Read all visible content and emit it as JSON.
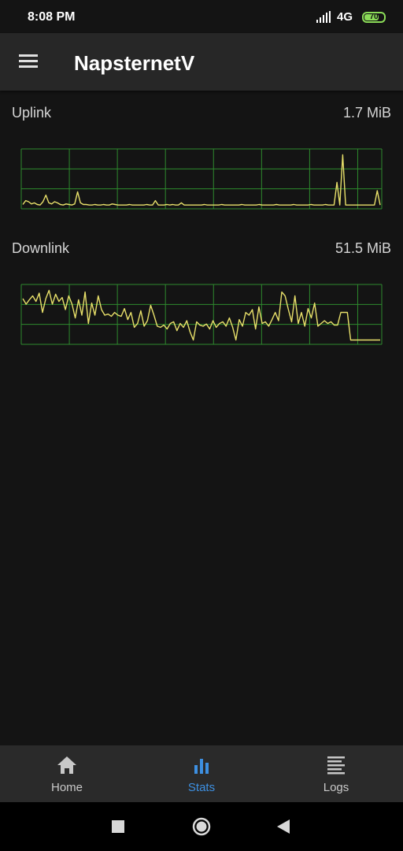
{
  "status_bar": {
    "time": "8:08 PM",
    "network": "4G",
    "battery_level": "70",
    "battery_color": "#8bdc58"
  },
  "app_bar": {
    "title": "NapsternetV",
    "menu_icon": "hamburger-menu-icon"
  },
  "stats": {
    "uplink": {
      "label": "Uplink",
      "value": "1.7 MiB",
      "trace": [
        0.05,
        0.12,
        0.1,
        0.06,
        0.08,
        0.05,
        0.04,
        0.1,
        0.22,
        0.08,
        0.06,
        0.1,
        0.08,
        0.05,
        0.04,
        0.06,
        0.05,
        0.04,
        0.06,
        0.28,
        0.08,
        0.05,
        0.05,
        0.04,
        0.04,
        0.05,
        0.04,
        0.04,
        0.05,
        0.04,
        0.04,
        0.06,
        0.05,
        0.04,
        0.04,
        0.04,
        0.04,
        0.05,
        0.04,
        0.04,
        0.04,
        0.04,
        0.04,
        0.05,
        0.04,
        0.04,
        0.12,
        0.04,
        0.04,
        0.04,
        0.05,
        0.04,
        0.05,
        0.04,
        0.04,
        0.08,
        0.04,
        0.04,
        0.04,
        0.04,
        0.04,
        0.04,
        0.04,
        0.05,
        0.04,
        0.04,
        0.04,
        0.04,
        0.04,
        0.05,
        0.04,
        0.04,
        0.04,
        0.04,
        0.04,
        0.04,
        0.05,
        0.04,
        0.04,
        0.04,
        0.04,
        0.04,
        0.05,
        0.04,
        0.04,
        0.04,
        0.04,
        0.04,
        0.05,
        0.04,
        0.04,
        0.04,
        0.04,
        0.04,
        0.05,
        0.04,
        0.04,
        0.04,
        0.04,
        0.04,
        0.05,
        0.04,
        0.04,
        0.04,
        0.04,
        0.05,
        0.04,
        0.04,
        0.04,
        0.45,
        0.04,
        0.95,
        0.04,
        0.04,
        0.04,
        0.04,
        0.04,
        0.04,
        0.04,
        0.04,
        0.04,
        0.04,
        0.04,
        0.3,
        0.04
      ],
      "line_color": "#e8e06a",
      "grid_color": "#2e8a2e"
    },
    "downlink": {
      "label": "Downlink",
      "value": "51.5 MiB",
      "trace": [
        0.8,
        0.7,
        0.78,
        0.85,
        0.75,
        0.9,
        0.55,
        0.8,
        0.95,
        0.7,
        0.88,
        0.75,
        0.82,
        0.6,
        0.85,
        0.7,
        0.45,
        0.78,
        0.5,
        0.92,
        0.35,
        0.72,
        0.5,
        0.85,
        0.6,
        0.5,
        0.52,
        0.48,
        0.55,
        0.5,
        0.48,
        0.62,
        0.42,
        0.55,
        0.28,
        0.35,
        0.58,
        0.3,
        0.4,
        0.68,
        0.5,
        0.3,
        0.28,
        0.32,
        0.25,
        0.35,
        0.38,
        0.22,
        0.35,
        0.28,
        0.4,
        0.2,
        0.05,
        0.38,
        0.32,
        0.3,
        0.34,
        0.25,
        0.4,
        0.28,
        0.35,
        0.38,
        0.3,
        0.45,
        0.28,
        0.05,
        0.42,
        0.3,
        0.55,
        0.5,
        0.6,
        0.25,
        0.65,
        0.35,
        0.38,
        0.3,
        0.42,
        0.55,
        0.4,
        0.92,
        0.85,
        0.6,
        0.38,
        0.85,
        0.35,
        0.55,
        0.3,
        0.62,
        0.45,
        0.72,
        0.3,
        0.35,
        0.4,
        0.35,
        0.38,
        0.32,
        0.32,
        0.55,
        0.55,
        0.55,
        0.05,
        0.05,
        0.05,
        0.05,
        0.05,
        0.05,
        0.05,
        0.05,
        0.05,
        0.05
      ],
      "line_color": "#e8e06a",
      "grid_color": "#2e8a2e"
    }
  },
  "bottom_nav": {
    "items": [
      {
        "label": "Home",
        "icon": "home-icon",
        "active": false
      },
      {
        "label": "Stats",
        "icon": "stats-bar-chart-icon",
        "active": true
      },
      {
        "label": "Logs",
        "icon": "logs-list-icon",
        "active": false
      }
    ],
    "active_color": "#3d8fe0"
  },
  "system_nav": {
    "buttons": [
      "recents-square-icon",
      "home-circle-icon",
      "back-triangle-icon"
    ]
  }
}
